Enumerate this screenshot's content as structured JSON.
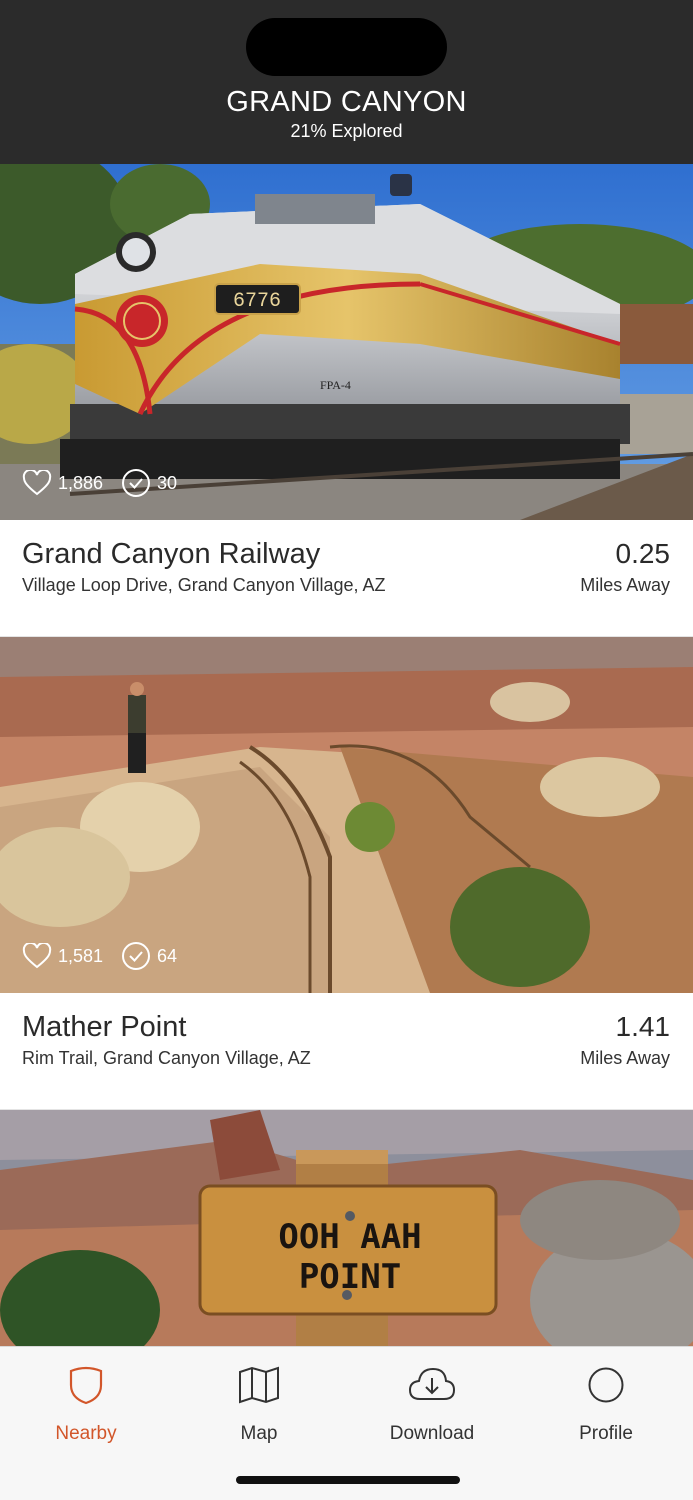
{
  "header": {
    "title": "GRAND CANYON",
    "subtitle": "21% Explored"
  },
  "places": [
    {
      "name": "Grand Canyon Railway",
      "address": "Village Loop Drive, Grand Canyon Village, AZ",
      "distance": "0.25",
      "distance_unit": "Miles Away",
      "likes": "1,886",
      "checkins": "30",
      "locomotive_number": "6776",
      "locomotive_model": "FPA-4"
    },
    {
      "name": "Mather Point",
      "address": "Rim Trail, Grand Canyon Village, AZ",
      "distance": "1.41",
      "distance_unit": "Miles Away",
      "likes": "1,581",
      "checkins": "64"
    },
    {
      "sign_line1": "OOH AAH",
      "sign_line2": "POINT"
    }
  ],
  "tabs": [
    {
      "label": "Nearby",
      "icon": "shield-icon",
      "active": true
    },
    {
      "label": "Map",
      "icon": "map-icon",
      "active": false
    },
    {
      "label": "Download",
      "icon": "cloud-download-icon",
      "active": false
    },
    {
      "label": "Profile",
      "icon": "circle-icon",
      "active": false
    }
  ],
  "colors": {
    "header_bg": "#2b2b2b",
    "accent": "#d2562a",
    "tabbar_bg": "#f7f7f7"
  }
}
